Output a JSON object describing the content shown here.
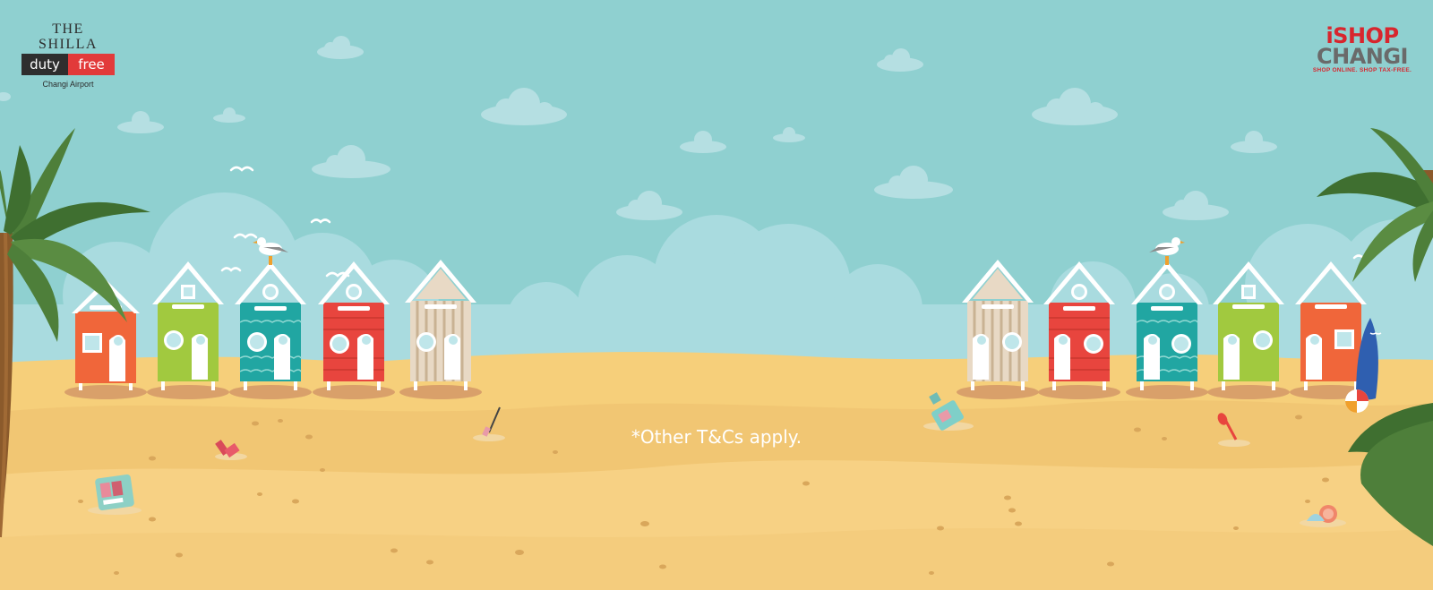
{
  "branding_left": {
    "line1": "THE SHILLA",
    "line2a": "duty",
    "line2b": "free",
    "line3": "Changi Airport"
  },
  "branding_right": {
    "line1": "iSHOP",
    "line2": "CHANGI",
    "tagline": "SHOP ONLINE. SHOP TAX-FREE."
  },
  "footnote": "*Other T&Cs apply.",
  "colors": {
    "sky": "#8fd0d0",
    "sand": "#f6cf7a",
    "hut_orange": "#f0663a",
    "hut_green": "#a1c93f",
    "hut_teal": "#21a6a2",
    "hut_red": "#e8453e",
    "hut_beige": "#e8d9c5",
    "palm_leaf": "#4e7f3a",
    "trunk": "#8b5a2b"
  },
  "huts_left": [
    "orange",
    "green",
    "teal",
    "red",
    "beige"
  ],
  "huts_right": [
    "beige",
    "red",
    "teal",
    "green",
    "orange"
  ]
}
